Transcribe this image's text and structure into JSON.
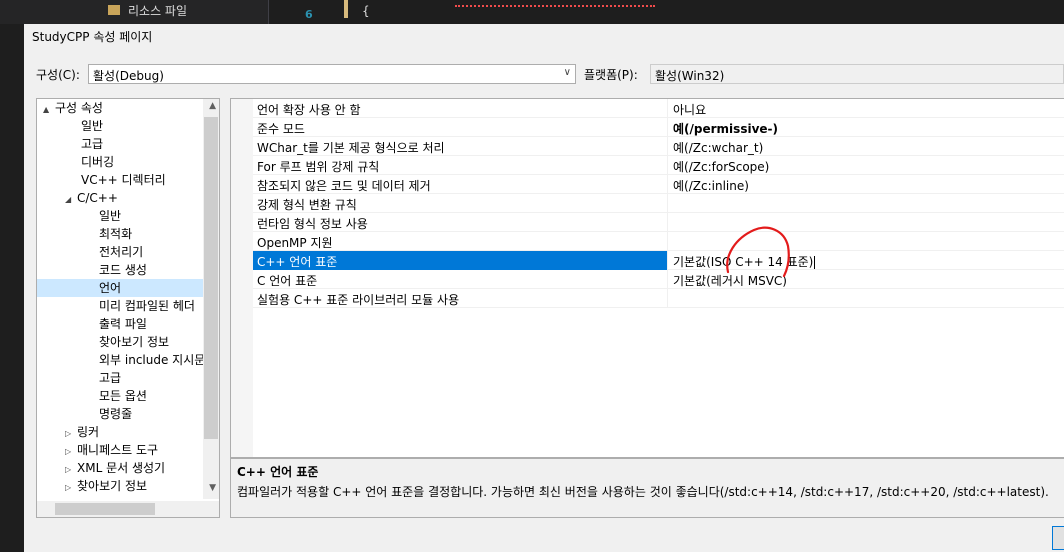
{
  "ide": {
    "tree_item": "리소스 파일",
    "line_number": "6",
    "brace": "{"
  },
  "dialog": {
    "title": "StudyCPP 속성 페이지",
    "config_label": "구성(C):",
    "config_value": "활성(Debug)",
    "platform_label": "플랫폼(P):",
    "platform_value": "활성(Win32)"
  },
  "tree": {
    "items": [
      {
        "label": "구성 속성",
        "expand": "▲"
      },
      {
        "label": "일반"
      },
      {
        "label": "고급"
      },
      {
        "label": "디버깅"
      },
      {
        "label": "VC++ 디렉터리"
      },
      {
        "label": "C/C++",
        "expand": "◢"
      },
      {
        "label": "일반"
      },
      {
        "label": "최적화"
      },
      {
        "label": "전처리기"
      },
      {
        "label": "코드 생성"
      },
      {
        "label": "언어"
      },
      {
        "label": "미리 컴파일된 헤더"
      },
      {
        "label": "출력 파일"
      },
      {
        "label": "찾아보기 정보"
      },
      {
        "label": "외부 include 지시문"
      },
      {
        "label": "고급"
      },
      {
        "label": "모든 옵션"
      },
      {
        "label": "명령줄"
      },
      {
        "label": "링커",
        "expand": "▷"
      },
      {
        "label": "매니페스트 도구",
        "expand": "▷"
      },
      {
        "label": "XML 문서 생성기",
        "expand": "▷"
      },
      {
        "label": "찾아보기 정보",
        "expand": "▷"
      }
    ]
  },
  "grid": {
    "rows": [
      {
        "name": "언어 확장 사용 안 함",
        "value": "아니요"
      },
      {
        "name": "준수 모드",
        "value": "예(/permissive-)"
      },
      {
        "name": "WChar_t를 기본 제공 형식으로 처리",
        "value": "예(/Zc:wchar_t)"
      },
      {
        "name": "For 루프 범위 강제 규칙",
        "value": "예(/Zc:forScope)"
      },
      {
        "name": "참조되지 않은 코드 및 데이터 제거",
        "value": "예(/Zc:inline)"
      },
      {
        "name": "강제 형식 변환 규칙",
        "value": ""
      },
      {
        "name": "런타임 형식 정보 사용",
        "value": ""
      },
      {
        "name": "OpenMP 지원",
        "value": ""
      },
      {
        "name": "C++ 언어 표준",
        "value": "기본값(ISO C++ 14 표준)"
      },
      {
        "name": "C 언어 표준",
        "value": "기본값(레거시 MSVC)"
      },
      {
        "name": "실험용 C++ 표준 라이브러리 모듈 사용",
        "value": ""
      }
    ]
  },
  "description": {
    "title": "C++ 언어 표준",
    "text": "컴파일러가 적용할 C++ 언어 표준을 결정합니다. 가능하면 최신 버전을 사용하는 것이 좋습니다(/std:c++14, /std:c++17, /std:c++20, /std:c++latest)."
  },
  "colors": {
    "selection": "#0078d7",
    "tree_selection": "#cce8ff",
    "annotation": "#e31b1b"
  }
}
